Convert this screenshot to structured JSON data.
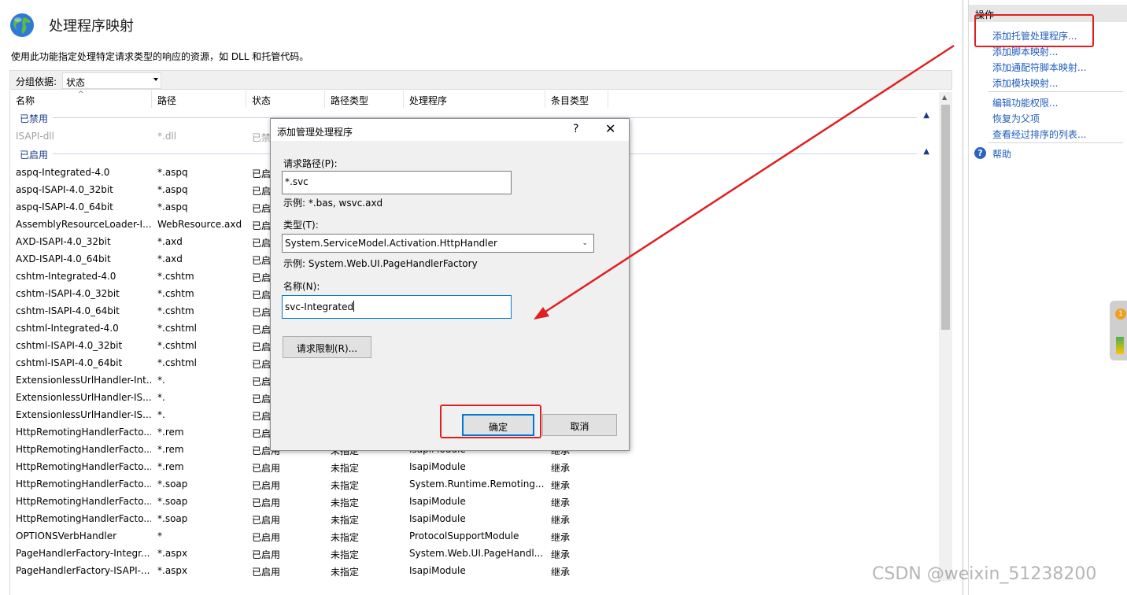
{
  "main": {
    "title": "处理程序映射",
    "description": "使用此功能指定处理特定请求类型的响应的资源，如 DLL 和托管代码。",
    "group_by_label": "分组依据:",
    "group_by_value": "状态",
    "columns": [
      "名称",
      "路径",
      "状态",
      "路径类型",
      "处理程序",
      "条目类型"
    ],
    "groups": [
      {
        "label": "已禁用",
        "rows": [
          [
            "ISAPI-dll",
            "*.dll",
            "已禁",
            "",
            "",
            ""
          ]
        ]
      },
      {
        "label": "已启用",
        "rows": [
          [
            "aspq-Integrated-4.0",
            "*.aspq",
            "已启",
            "",
            "",
            ""
          ],
          [
            "aspq-ISAPI-4.0_32bit",
            "*.aspq",
            "已启",
            "",
            "",
            ""
          ],
          [
            "aspq-ISAPI-4.0_64bit",
            "*.aspq",
            "已启",
            "",
            "",
            ""
          ],
          [
            "AssemblyResourceLoader-I...",
            "WebResource.axd",
            "已启",
            "",
            "",
            ""
          ],
          [
            "AXD-ISAPI-4.0_32bit",
            "*.axd",
            "已启",
            "",
            "",
            ""
          ],
          [
            "AXD-ISAPI-4.0_64bit",
            "*.axd",
            "已启",
            "",
            "",
            ""
          ],
          [
            "cshtm-Integrated-4.0",
            "*.cshtm",
            "已启",
            "",
            "",
            ""
          ],
          [
            "cshtm-ISAPI-4.0_32bit",
            "*.cshtm",
            "已启",
            "",
            "",
            ""
          ],
          [
            "cshtm-ISAPI-4.0_64bit",
            "*.cshtm",
            "已启",
            "",
            "",
            ""
          ],
          [
            "cshtml-Integrated-4.0",
            "*.cshtml",
            "已启",
            "",
            "",
            ""
          ],
          [
            "cshtml-ISAPI-4.0_32bit",
            "*.cshtml",
            "已启",
            "",
            "",
            ""
          ],
          [
            "cshtml-ISAPI-4.0_64bit",
            "*.cshtml",
            "已启",
            "",
            "",
            ""
          ],
          [
            "ExtensionlessUrlHandler-Int...",
            "*.",
            "已启",
            "",
            "",
            ""
          ],
          [
            "ExtensionlessUrlHandler-IS...",
            "*.",
            "已启",
            "",
            "",
            ""
          ],
          [
            "ExtensionlessUrlHandler-IS...",
            "*.",
            "已启",
            "",
            "",
            ""
          ],
          [
            "HttpRemotingHandlerFacto...",
            "*.rem",
            "已启",
            "",
            "",
            ""
          ],
          [
            "HttpRemotingHandlerFacto...",
            "*.rem",
            "已启用",
            "未指定",
            "IsapiModule",
            "继承"
          ],
          [
            "HttpRemotingHandlerFacto...",
            "*.rem",
            "已启用",
            "未指定",
            "IsapiModule",
            "继承"
          ],
          [
            "HttpRemotingHandlerFacto...",
            "*.soap",
            "已启用",
            "未指定",
            "System.Runtime.Remoting....",
            "继承"
          ],
          [
            "HttpRemotingHandlerFacto...",
            "*.soap",
            "已启用",
            "未指定",
            "IsapiModule",
            "继承"
          ],
          [
            "HttpRemotingHandlerFacto...",
            "*.soap",
            "已启用",
            "未指定",
            "IsapiModule",
            "继承"
          ],
          [
            "OPTIONSVerbHandler",
            "*",
            "已启用",
            "未指定",
            "ProtocolSupportModule",
            "继承"
          ],
          [
            "PageHandlerFactory-Integr...",
            "*.aspx",
            "已启用",
            "未指定",
            "System.Web.UI.PageHandl...",
            "继承"
          ],
          [
            "PageHandlerFactory-ISAPI-...",
            "*.aspx",
            "已启用",
            "未指定",
            "IsapiModule",
            "继承"
          ]
        ]
      }
    ]
  },
  "actions": {
    "header": "操作",
    "group1": [
      "添加托管处理程序...",
      "添加脚本映射...",
      "添加通配符脚本映射...",
      "添加模块映射..."
    ],
    "group2": [
      "编辑功能权限...",
      "恢复为父项",
      "查看经过排序的列表..."
    ],
    "help": "帮助"
  },
  "dialog": {
    "title": "添加管理处理程序",
    "help_symbol": "?",
    "close_symbol": "✕",
    "request_path_label": "请求路径(P):",
    "request_path_value": "*.svc",
    "request_path_hint": "示例: *.bas, wsvc.axd",
    "type_label": "类型(T):",
    "type_value": "System.ServiceModel.Activation.HttpHandler",
    "type_hint": "示例: System.Web.UI.PageHandlerFactory",
    "name_label": "名称(N):",
    "name_value": "svc-Integrated",
    "restrictions_button": "请求限制(R)...",
    "ok_button": "确定",
    "cancel_button": "取消"
  },
  "side_widget": {
    "badge": "1"
  },
  "watermark": "CSDN @weixin_51238200",
  "colors": {
    "annotation_red": "#e02020",
    "link_blue": "#1f5cbf",
    "focus_blue": "#0078d7"
  }
}
